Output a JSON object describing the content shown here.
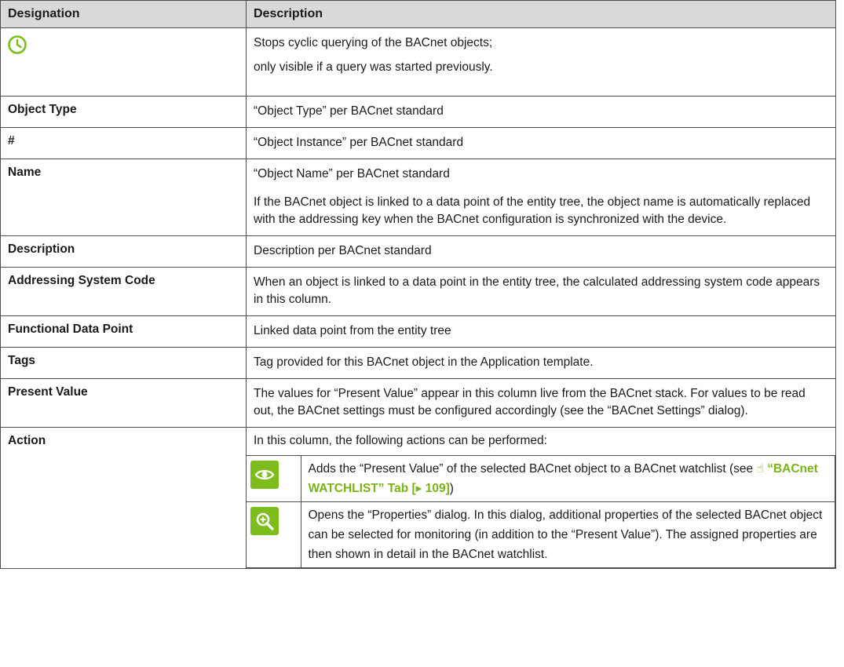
{
  "header": {
    "designation": "Designation",
    "description": "Description"
  },
  "stop_row": {
    "line1": "Stops cyclic querying of the BACnet objects;",
    "line2": "only visible if a query was started previously."
  },
  "rows": [
    {
      "designation": "Object Type",
      "description": "“Object Type” per BACnet standard"
    },
    {
      "designation": "#",
      "description": "“Object Instance” per BACnet standard"
    },
    {
      "designation": "Name",
      "description": "“Object Name” per BACnet standard",
      "note": "If the BACnet object is linked to a data point of the entity tree, the object name is automatically replaced with the addressing key when the BACnet configuration is synchronized with the device."
    },
    {
      "designation": "Description",
      "description": "Description per BACnet standard"
    },
    {
      "designation": "Addressing System Code",
      "description": "When an object is linked to a data point in the entity tree, the calculated addressing system code appears in this column."
    },
    {
      "designation": "Functional Data Point",
      "description": "Linked data point from the entity tree"
    },
    {
      "designation": "Tags",
      "description": "Tag provided for this BACnet object in the Application template."
    },
    {
      "designation": "Present Value",
      "description": "The values for “Present Value” appear in this column live from the BACnet stack. For values to be read out, the BACnet settings must be configured accordingly (see the “BACnet Settings” dialog)."
    },
    {
      "designation": "Action",
      "description": "In this column, the following actions can be performed:"
    }
  ],
  "actions": [
    {
      "icon": "eye-icon",
      "text": "Adds the “Present Value” of the selected BACnet object to a BACnet watchlist (see ",
      "link": "“BACnet WATCHLIST” Tab [▸ 109]",
      "suffix": ")"
    },
    {
      "icon": "zoom-in-icon",
      "text": "Opens the “Properties” dialog. In this dialog, additional properties of the selected BACnet object can be selected for monitoring (in addition to the “Present Value”). The assigned properties are then shown in detail in the BACnet watchlist."
    }
  ],
  "colors": {
    "accent": "#7cbd1c",
    "header_bg": "#d9d9d9",
    "link": "#7ab317"
  }
}
